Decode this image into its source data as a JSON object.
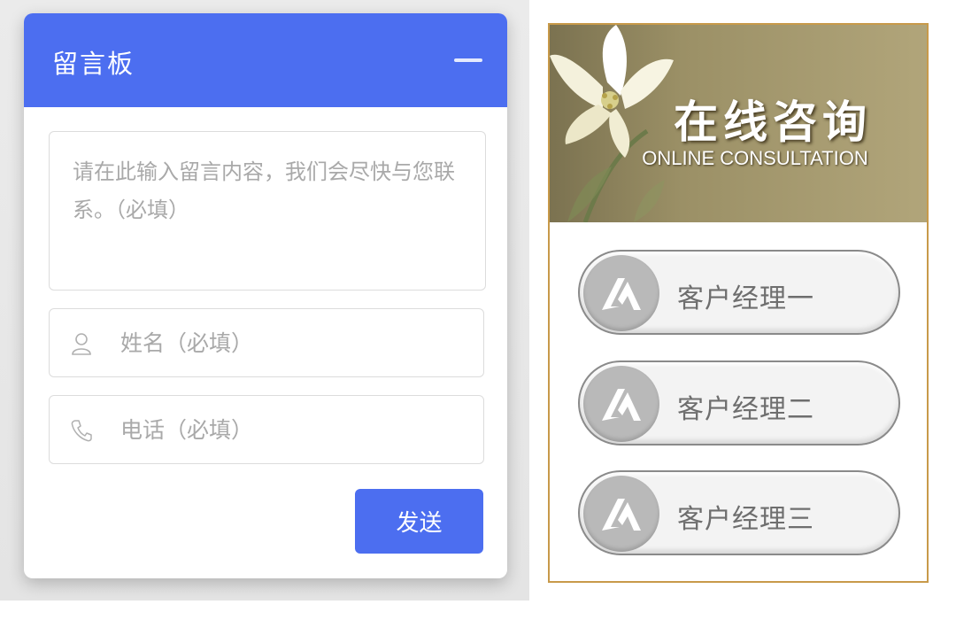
{
  "message_board": {
    "title": "留言板",
    "minimize_icon": "minus-icon",
    "message_placeholder": "请在此输入留言内容，我们会尽快与您联系。（必填）",
    "name_placeholder": "姓名（必填）",
    "name_icon": "user-icon",
    "phone_placeholder": "电话（必填）",
    "phone_icon": "phone-icon",
    "send_label": "发送",
    "accent_color": "#4c6ef0"
  },
  "consultation": {
    "title": "在线咨询",
    "subtitle": "ONLINE CONSULTATION",
    "banner_icon": "lily-flower",
    "border_color": "#c89a4a",
    "managers": [
      {
        "label": "客户经理一",
        "icon": "chat-logo-icon"
      },
      {
        "label": "客户经理二",
        "icon": "chat-logo-icon"
      },
      {
        "label": "客户经理三",
        "icon": "chat-logo-icon"
      }
    ]
  }
}
